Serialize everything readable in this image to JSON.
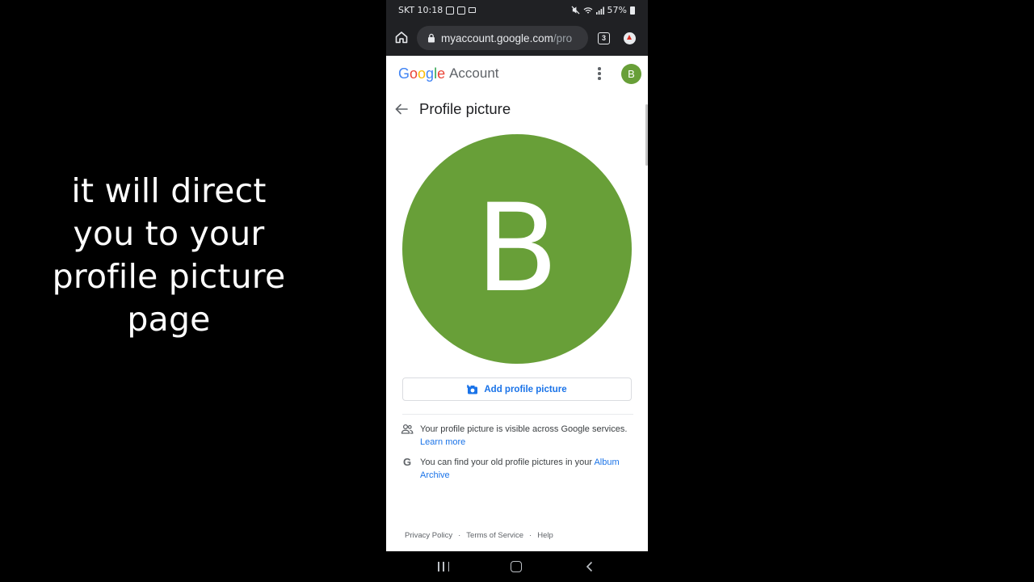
{
  "caption": {
    "line1": "it will direct",
    "line2": "you to your",
    "line3": "profile picture",
    "line4": "page"
  },
  "status_bar": {
    "carrier_time": "SKT 10:18",
    "battery": "57%"
  },
  "browser": {
    "url_host": "myaccount.google.com",
    "url_path": "/pro",
    "tab_count": "3"
  },
  "header": {
    "logo_letters": [
      "G",
      "o",
      "o",
      "g",
      "l",
      "e"
    ],
    "account_label": "Account",
    "avatar_initial": "B"
  },
  "page": {
    "title": "Profile picture",
    "avatar_initial": "B",
    "add_button_label": "Add profile picture",
    "info1_text": "Your profile picture is visible across Google services.",
    "info1_link": "Learn more",
    "info2_text": "You can find your old profile pictures in your",
    "info2_link": "Album Archive"
  },
  "footer": {
    "privacy": "Privacy Policy",
    "terms": "Terms of Service",
    "help": "Help",
    "separator": "·"
  },
  "colors": {
    "avatar_green": "#689f38",
    "link_blue": "#1a73e8",
    "chrome_dark": "#202124"
  }
}
